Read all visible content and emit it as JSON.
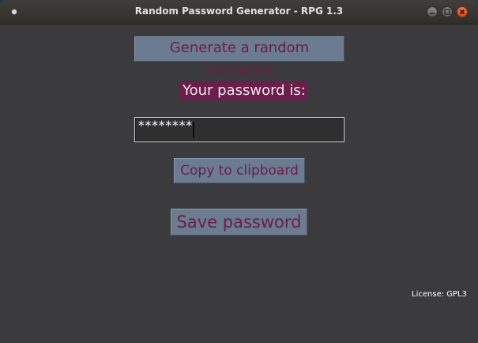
{
  "window": {
    "title": "Random Password Generator - RPG 1.3",
    "icon": "app-dot-icon",
    "controls": [
      "minimize-icon",
      "maximize-icon",
      "close-icon"
    ]
  },
  "main": {
    "generate_label": "Generate a random password",
    "your_password_label": "Your password is:",
    "password_value": "********",
    "copy_label": "Copy to clipboard",
    "save_label": "Save password",
    "license_text": "License: GPL3"
  },
  "colors": {
    "button_bg": "#6b7b90",
    "button_text": "#6b1d4b",
    "label_bg": "#6b1d4b",
    "window_bg": "#3b3b3d",
    "close_button": "#e5602f"
  }
}
